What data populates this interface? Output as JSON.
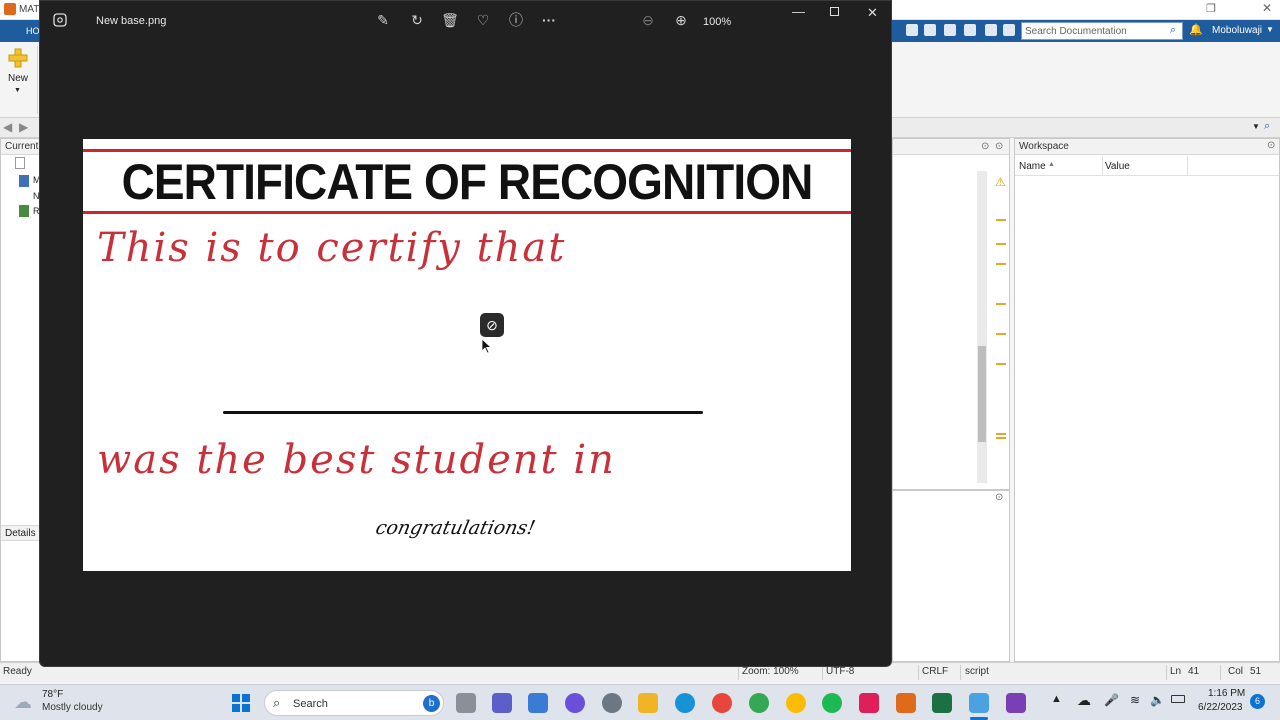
{
  "matlab": {
    "title_fragment": "MAT",
    "home_tab_fragment": "HO",
    "new_label": "New",
    "search_placeholder": "Search Documentation",
    "user": "Moboluwaji",
    "current_folder_fragment": "Current",
    "file_fragments": [
      "M",
      "N",
      "R"
    ],
    "details_label": "Details",
    "workspace": {
      "title": "Workspace",
      "col_name": "Name",
      "col_value": "Value"
    },
    "status": {
      "ready": "Ready",
      "zoom": "Zoom: 100%",
      "encoding": "UTF-8",
      "line_ending": "CRLF",
      "type": "script",
      "ln_label": "Ln",
      "ln_value": "41",
      "col_label": "Col",
      "col_value": "51"
    }
  },
  "viewer": {
    "filename": "New base.png",
    "zoom": "100%",
    "toolbar_icons": [
      "edit-icon",
      "rotate-icon",
      "delete-icon",
      "favorite-icon",
      "info-icon",
      "more-icon",
      "zoom-out-icon",
      "zoom-in-icon"
    ],
    "window_controls": [
      "minimize-icon",
      "maximize-icon",
      "close-icon"
    ]
  },
  "certificate": {
    "title": "CERTIFICATE OF RECOGNITION",
    "line1": "This is to certify that",
    "line2": "was the best student in",
    "footer": "congratulations!",
    "accent_color": "#c8282e"
  },
  "taskbar": {
    "temperature": "78°F",
    "weather": "Mostly cloudy",
    "search_label": "Search",
    "time": "1:16 PM",
    "date": "6/22/2023",
    "notification_count": "6"
  }
}
